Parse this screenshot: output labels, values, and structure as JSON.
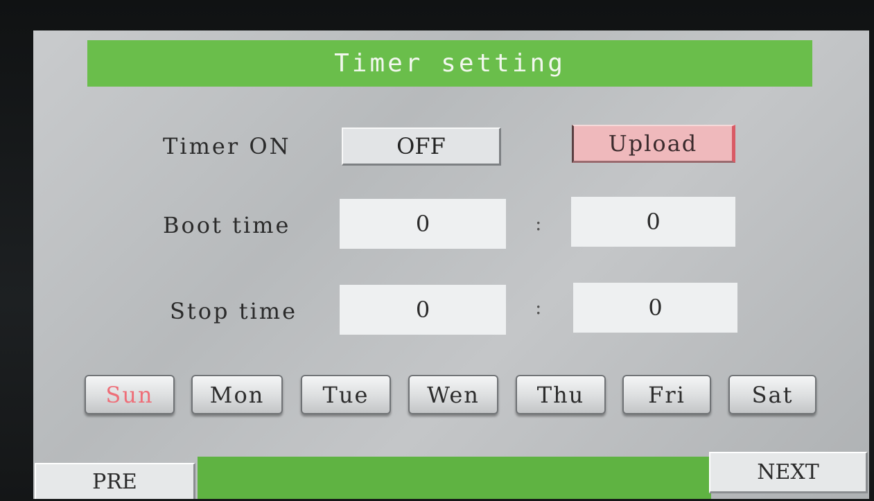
{
  "header": {
    "title": "Timer setting"
  },
  "timer": {
    "label": "Timer ON",
    "toggle_value": "OFF",
    "upload_label": "Upload"
  },
  "boot": {
    "label": "Boot time",
    "hour": "0",
    "separator": ":",
    "minute": "0"
  },
  "stop": {
    "label": "Stop time",
    "hour": "0",
    "separator": ":",
    "minute": "0"
  },
  "days": {
    "items": [
      {
        "label": "Sun",
        "selected": true
      },
      {
        "label": "Mon",
        "selected": false
      },
      {
        "label": "Tue",
        "selected": false
      },
      {
        "label": "Wen",
        "selected": false
      },
      {
        "label": "Thu",
        "selected": false
      },
      {
        "label": "Fri",
        "selected": false
      },
      {
        "label": "Sat",
        "selected": false
      }
    ]
  },
  "nav": {
    "prev_label": "PRE",
    "next_label": "NEXT"
  },
  "colors": {
    "title_green": "#6abe4b",
    "bottom_green": "#5fb342",
    "upload_pink": "#efb9bc",
    "selected_day_red": "#ee6e78"
  }
}
